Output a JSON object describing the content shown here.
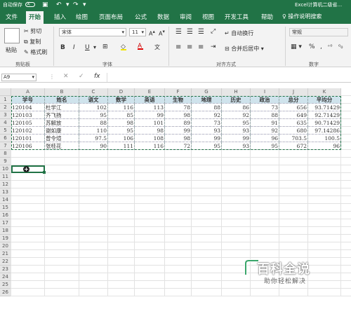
{
  "title_bar": {
    "autosave": "自动保存",
    "toggle": "关",
    "file_name": "Excel计算机二级省..."
  },
  "menu": {
    "tabs": [
      "文件",
      "开始",
      "插入",
      "绘图",
      "页面布局",
      "公式",
      "数据",
      "审阅",
      "视图",
      "开发工具",
      "帮助"
    ],
    "active": "开始",
    "search": "操作说明搜索"
  },
  "ribbon": {
    "clipboard": {
      "paste": "粘贴",
      "cut": "剪切",
      "copy": "复制",
      "format_painter": "格式刷",
      "label": "剪贴板"
    },
    "font": {
      "name": "宋体",
      "size": "11",
      "label": "字体",
      "bold": "B",
      "italic": "I",
      "underline": "U"
    },
    "alignment": {
      "wrap": "自动换行",
      "merge": "合并后居中",
      "label": "对齐方式"
    },
    "number": {
      "format": "常规",
      "label": "数字"
    }
  },
  "formula_bar": {
    "name_box": "A9",
    "fx": "fx",
    "content": ""
  },
  "columns": [
    "A",
    "B",
    "C",
    "D",
    "E",
    "F",
    "G",
    "H",
    "I",
    "J",
    "K"
  ],
  "rows": [
    "1",
    "2",
    "3",
    "4",
    "5",
    "6",
    "7",
    "8",
    "9",
    "10",
    "11",
    "12",
    "13",
    "14",
    "15",
    "16",
    "17",
    "18",
    "19",
    "20",
    "21",
    "22",
    "23",
    "24",
    "25",
    "26"
  ],
  "table": {
    "headers": [
      "学号",
      "姓名",
      "语文",
      "数学",
      "英语",
      "生物",
      "地理",
      "历史",
      "政治",
      "总分",
      "平均分"
    ],
    "rows": [
      [
        "120104",
        "杜学江",
        "102",
        "116",
        "113",
        "78",
        "88",
        "86",
        "73",
        "656",
        "93.71429"
      ],
      [
        "120103",
        "齐飞扬",
        "95",
        "85",
        "99",
        "98",
        "92",
        "92",
        "88",
        "649",
        "92.71429"
      ],
      [
        "120105",
        "苏解放",
        "88",
        "98",
        "101",
        "89",
        "73",
        "95",
        "91",
        "635",
        "90.71429"
      ],
      [
        "120102",
        "谢如康",
        "110",
        "95",
        "98",
        "99",
        "93",
        "93",
        "92",
        "680",
        "97.14286"
      ],
      [
        "120101",
        "曾令煊",
        "97.5",
        "106",
        "108",
        "98",
        "99",
        "99",
        "96",
        "703.5",
        "100.5"
      ],
      [
        "120106",
        "张桂花",
        "90",
        "111",
        "116",
        "72",
        "95",
        "93",
        "95",
        "672",
        "96"
      ]
    ]
  },
  "header_fill": "#cfe3ec",
  "accent": "#217346",
  "watermark": {
    "main": "百科全说",
    "sub": "助你轻松解决"
  }
}
